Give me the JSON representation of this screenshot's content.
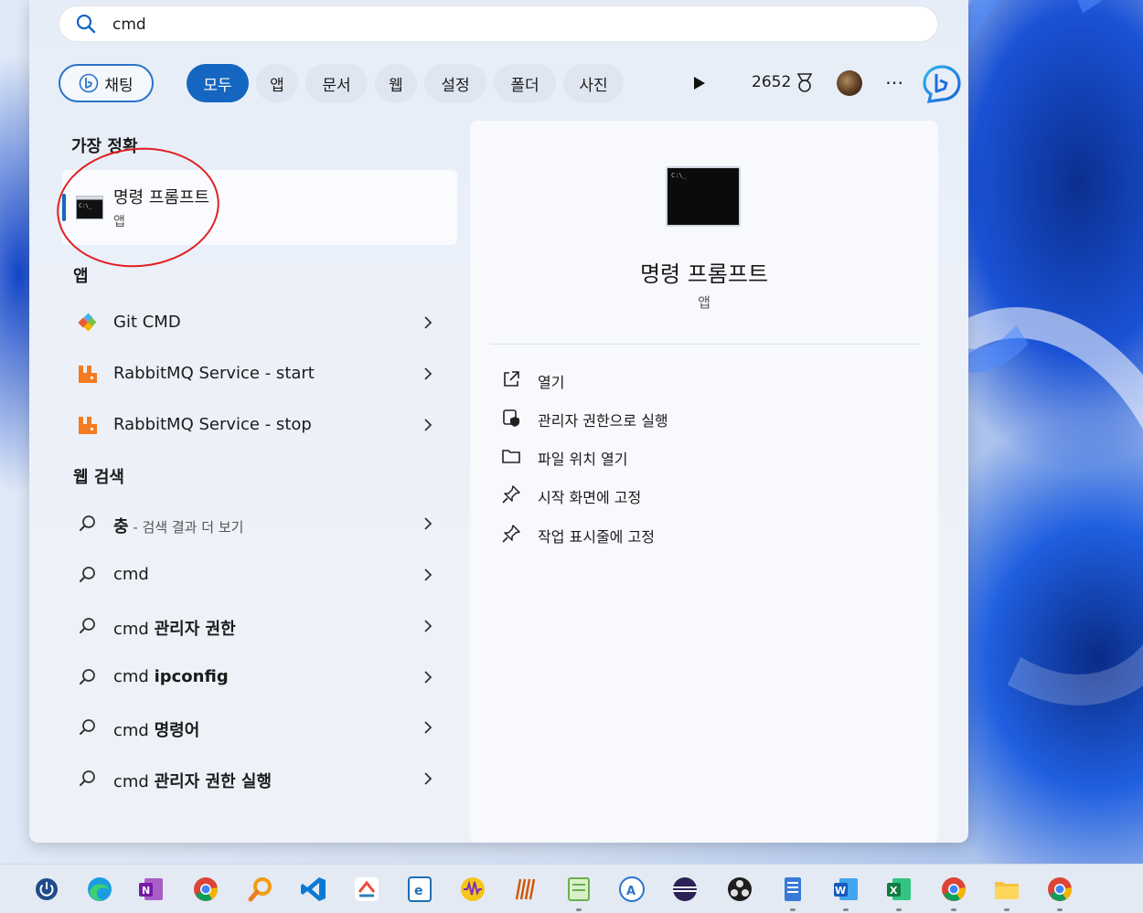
{
  "search": {
    "query": "cmd"
  },
  "chips": [
    {
      "label": "채팅"
    },
    {
      "label": "모두"
    },
    {
      "label": "앱"
    },
    {
      "label": "문서"
    },
    {
      "label": "웹"
    },
    {
      "label": "설정"
    },
    {
      "label": "폴더"
    },
    {
      "label": "사진"
    }
  ],
  "rewards": {
    "points": "2652"
  },
  "best_match": {
    "section_title": "가장 정확",
    "name": "명령 프롬프트",
    "kind": "앱"
  },
  "apps": {
    "section_title": "앱",
    "items": [
      {
        "label": "Git CMD",
        "icon": "git-icon"
      },
      {
        "label": "RabbitMQ Service - start",
        "icon": "rabbitmq-icon"
      },
      {
        "label": "RabbitMQ Service - stop",
        "icon": "rabbitmq-icon"
      }
    ]
  },
  "web": {
    "section_title": "웹 검색",
    "first": {
      "term": "충",
      "suffix": " - 검색 결과 더 보기"
    },
    "items": [
      {
        "prefix": "cmd",
        "bold": ""
      },
      {
        "prefix": "cmd ",
        "bold": "관리자 권한"
      },
      {
        "prefix": "cmd ",
        "bold": "ipconfig"
      },
      {
        "prefix": "cmd ",
        "bold": "명령어"
      },
      {
        "prefix": "cmd ",
        "bold": "관리자 권한 실행"
      }
    ]
  },
  "detail": {
    "icon_text": "C:\\_",
    "title": "명령 프롬프트",
    "kind": "앱",
    "actions": [
      {
        "label": "열기",
        "icon": "open-external-icon"
      },
      {
        "label": "관리자 권한으로 실행",
        "icon": "admin-shield-icon"
      },
      {
        "label": "파일 위치 열기",
        "icon": "folder-icon"
      },
      {
        "label": "시작 화면에 고정",
        "icon": "pin-icon"
      },
      {
        "label": "작업 표시줄에 고정",
        "icon": "pin-icon"
      }
    ]
  },
  "taskbar": {
    "apps": [
      "power-icon",
      "edge-icon",
      "onenote-icon",
      "chrome-icon",
      "search-tool-icon",
      "vscode-icon",
      "app-icon",
      "editor-icon",
      "audio-icon",
      "bars-icon",
      "notepad-icon",
      "translator-icon",
      "eclipse-icon",
      "obs-icon",
      "notes-icon",
      "word-icon",
      "excel-icon",
      "chrome-profile-icon",
      "explorer-icon",
      "chrome-dev-icon"
    ]
  }
}
